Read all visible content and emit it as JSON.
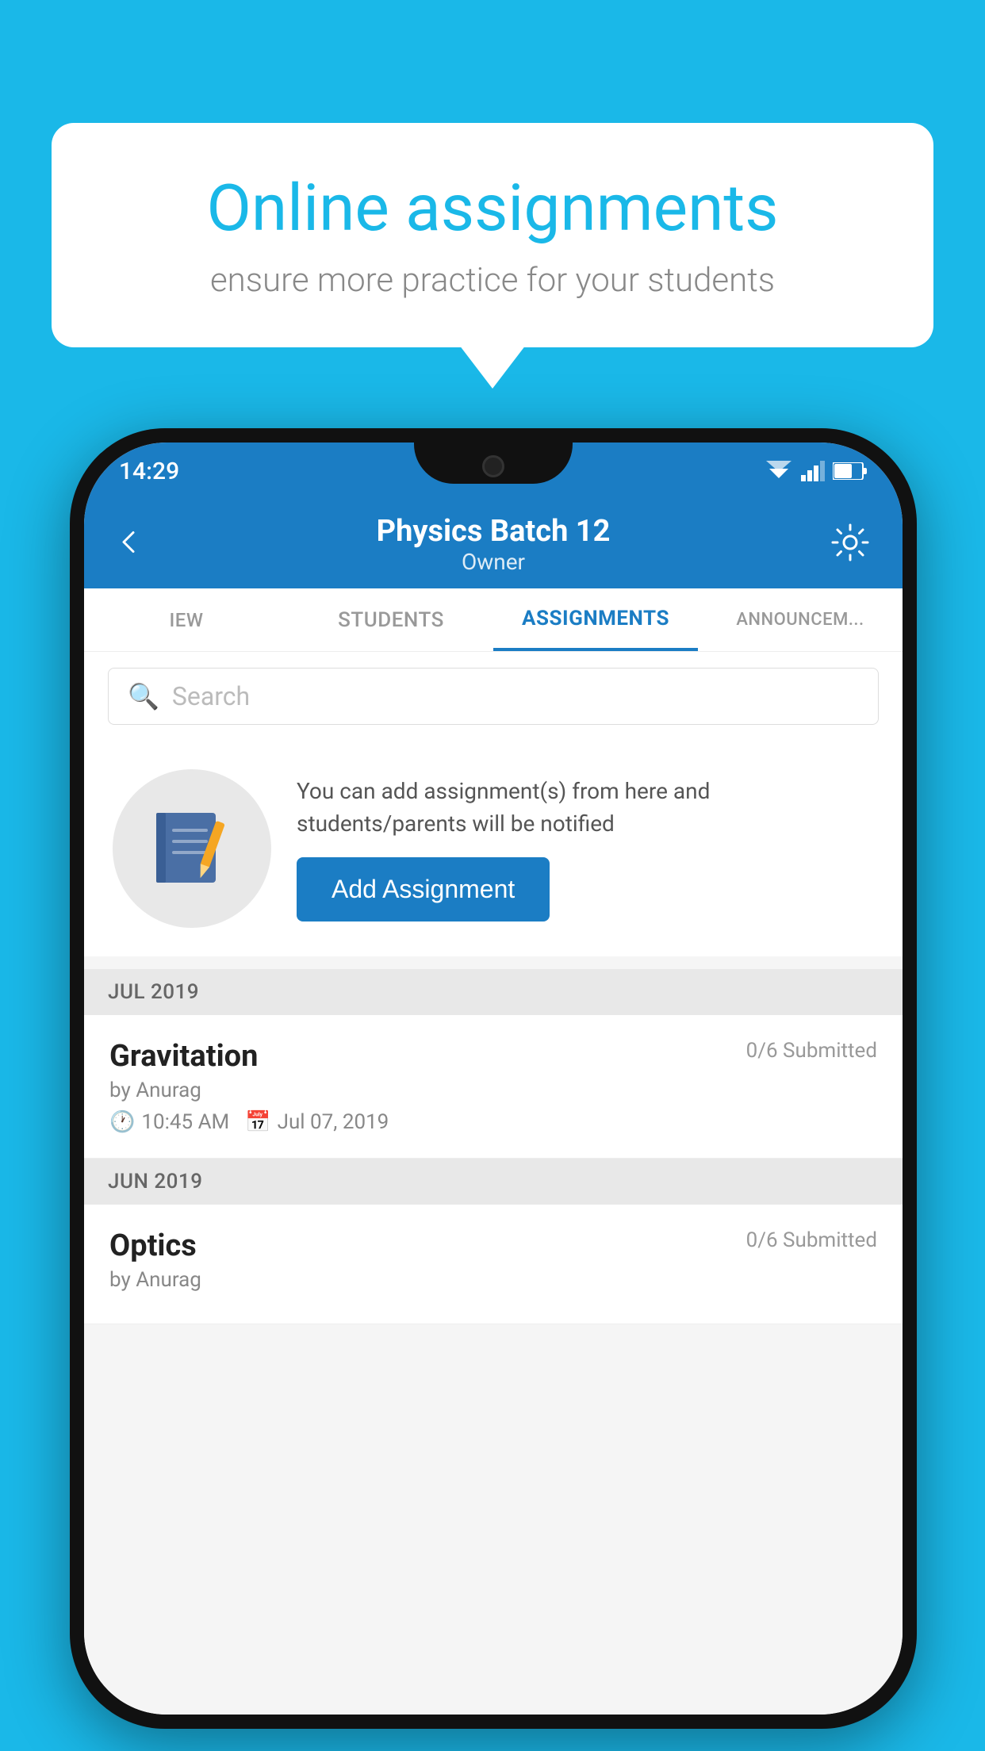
{
  "background_color": "#1AB8E8",
  "speech_bubble": {
    "title": "Online assignments",
    "subtitle": "ensure more practice for your students"
  },
  "status_bar": {
    "time": "14:29",
    "wifi": "▼",
    "signal": "▲",
    "battery": "■"
  },
  "header": {
    "title": "Physics Batch 12",
    "subtitle": "Owner",
    "back_label": "←",
    "settings_label": "⚙"
  },
  "tabs": [
    {
      "label": "IEW",
      "active": false
    },
    {
      "label": "STUDENTS",
      "active": false
    },
    {
      "label": "ASSIGNMENTS",
      "active": true
    },
    {
      "label": "ANNOUNCEM...",
      "active": false
    }
  ],
  "search": {
    "placeholder": "Search",
    "icon": "🔍"
  },
  "promo": {
    "description": "You can add assignment(s) from here and students/parents will be notified",
    "button_label": "Add Assignment"
  },
  "sections": [
    {
      "label": "JUL 2019",
      "assignments": [
        {
          "name": "Gravitation",
          "submitted": "0/6 Submitted",
          "by": "by Anurag",
          "time": "10:45 AM",
          "date": "Jul 07, 2019"
        }
      ]
    },
    {
      "label": "JUN 2019",
      "assignments": [
        {
          "name": "Optics",
          "submitted": "0/6 Submitted",
          "by": "by Anurag",
          "time": "",
          "date": ""
        }
      ]
    }
  ]
}
